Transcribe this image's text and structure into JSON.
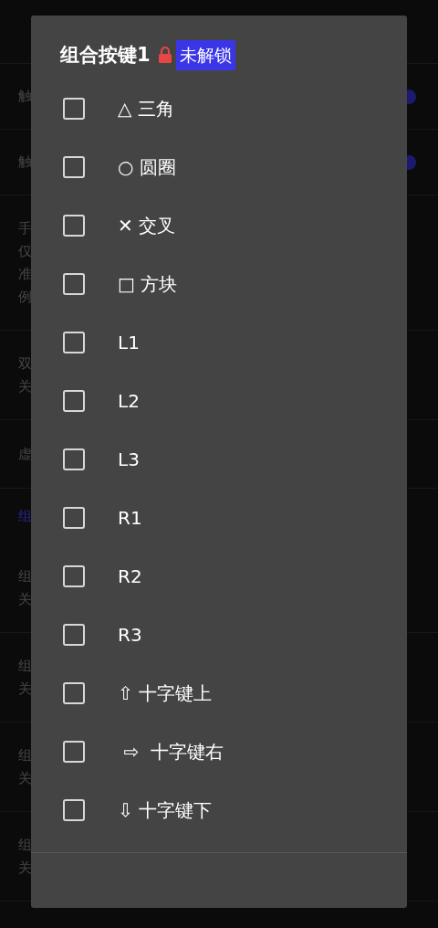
{
  "background": {
    "rows": [
      {
        "kind": "setting",
        "lines": [
          "触"
        ],
        "switch_on": true
      },
      {
        "kind": "setting",
        "lines": [
          "触"
        ],
        "switch_on": true
      },
      {
        "kind": "setting",
        "lines": [
          "手",
          "仅",
          "准",
          "例"
        ]
      },
      {
        "kind": "setting",
        "lines": [
          "双",
          "关"
        ]
      },
      {
        "kind": "setting",
        "lines": [
          "虚"
        ]
      },
      {
        "kind": "header",
        "lines": [
          "组"
        ]
      },
      {
        "kind": "setting",
        "lines": [
          "组",
          "关"
        ]
      },
      {
        "kind": "setting",
        "lines": [
          "组",
          "关"
        ]
      },
      {
        "kind": "setting",
        "lines": [
          "组",
          "关"
        ]
      },
      {
        "kind": "setting",
        "lines": [
          "组",
          "关"
        ]
      }
    ]
  },
  "dialog": {
    "title": "组合按键1",
    "badge": "未解锁",
    "locked": true,
    "items": [
      {
        "label": "△ 三角",
        "checked": false
      },
      {
        "label": "○ 圆圈",
        "checked": false
      },
      {
        "label": "✕ 交叉",
        "checked": false
      },
      {
        "label": "□ 方块",
        "checked": false
      },
      {
        "label": "L1",
        "checked": false
      },
      {
        "label": "L2",
        "checked": false
      },
      {
        "label": "L3",
        "checked": false
      },
      {
        "label": "R1",
        "checked": false
      },
      {
        "label": "R2",
        "checked": false
      },
      {
        "label": "R3",
        "checked": false
      },
      {
        "label": "⇧ 十字键上",
        "checked": false
      },
      {
        "label": " ⇨  十字键右",
        "checked": false
      },
      {
        "label": "⇩ 十字键下",
        "checked": false
      }
    ]
  }
}
